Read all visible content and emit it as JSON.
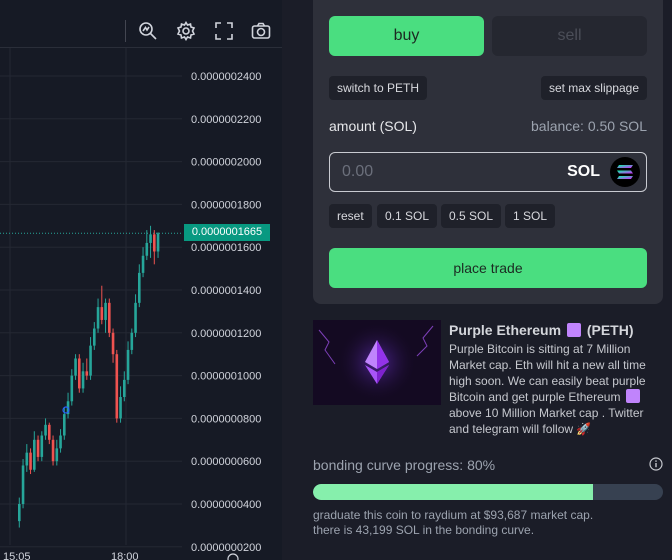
{
  "chart": {
    "price_labels": [
      "0.0000002400",
      "0.0000002200",
      "0.0000002000",
      "0.0000001800",
      "0.0000001600",
      "0.0000001400",
      "0.0000001200",
      "0.0000001000",
      "0.0000000800",
      "0.0000000600",
      "0.0000000400",
      "0.0000000200"
    ],
    "last_price": "0.0000001665",
    "time_labels": [
      "15:05",
      "18:00"
    ],
    "up_color": "#26a69a",
    "down_color": "#ef5350"
  },
  "toolbar": {
    "icons": [
      "magnifier-chart-icon",
      "gear-icon",
      "fullscreen-icon",
      "camera-icon"
    ]
  },
  "trade": {
    "buy_label": "buy",
    "sell_label": "sell",
    "switch_label": "switch to PETH",
    "slippage_label": "set max slippage",
    "amount_label": "amount (SOL)",
    "balance_label": "balance: 0.50 SOL",
    "amount_placeholder": "0.00",
    "unit": "SOL",
    "quick_amounts": [
      "reset",
      "0.1 SOL",
      "0.5 SOL",
      "1 SOL"
    ],
    "place_label": "place trade",
    "accent": "#4ade80"
  },
  "token": {
    "name": "Purple Ethereum",
    "ticker": "(PETH)",
    "description": "Purple Bitcoin is sitting at 7 Million Market cap. Eth will hit a new all time high soon. We can easily beat purple Bitcoin and get purple Ethereum",
    "description_end": "above 10 Million Market cap . Twitter and telegram will follow",
    "emoji": "🚀"
  },
  "bonding": {
    "label": "bonding curve progress: 80%",
    "progress": 0.8,
    "graduate_text": "graduate this coin to raydium at $93,687 market cap.",
    "sol_text": "there is 43,199 SOL in the bonding curve."
  }
}
